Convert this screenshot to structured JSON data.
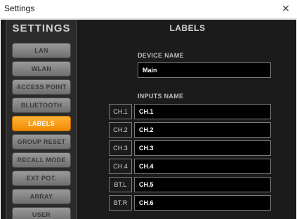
{
  "window": {
    "title": "Settings",
    "close_symbol": "✕"
  },
  "sidebar": {
    "title": "SETTINGS",
    "items": [
      {
        "label": "LAN"
      },
      {
        "label": "WLAN"
      },
      {
        "label": "ACCESS POINT"
      },
      {
        "label": "BLUETOOTH"
      },
      {
        "label": "LABELS",
        "active": true
      },
      {
        "label": "GROUP RESET"
      },
      {
        "label": "RECALL MODE"
      },
      {
        "label": "EXT POT."
      },
      {
        "label": "ARRAY"
      },
      {
        "label": "USER"
      }
    ]
  },
  "main": {
    "title": "LABELS",
    "device_name_label": "DEVICE NAME",
    "device_name_value": "Main",
    "inputs_name_label": "INPUTS NAME",
    "inputs": [
      {
        "channel": "CH.1",
        "name": "CH.1"
      },
      {
        "channel": "CH.2",
        "name": "CH.2"
      },
      {
        "channel": "CH.3",
        "name": "CH.3"
      },
      {
        "channel": "CH.4",
        "name": "CH.4"
      },
      {
        "channel": "BT.L",
        "name": "CH.5"
      },
      {
        "channel": "BT.R",
        "name": "CH.6"
      }
    ]
  },
  "colors": {
    "accent": "#f5a018",
    "background": "#1b1b1b",
    "nav_button": "#8a8a8a"
  }
}
